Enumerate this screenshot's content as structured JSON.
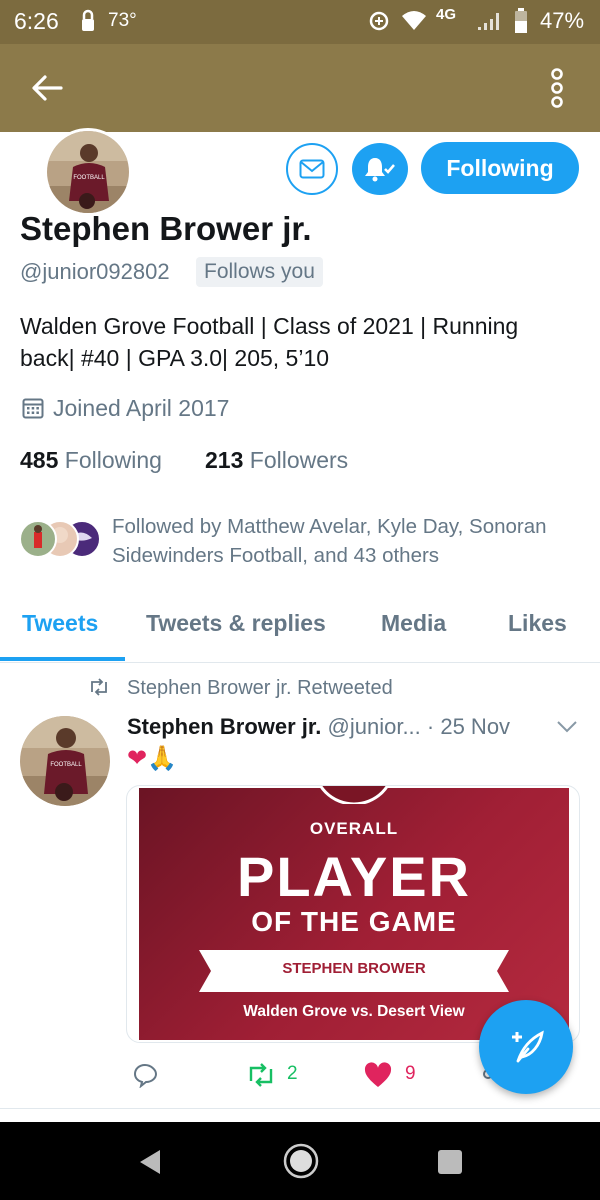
{
  "status": {
    "time": "6:26",
    "temp": "73°",
    "network": "4G",
    "battery": "47%"
  },
  "profile": {
    "name": "Stephen Brower jr.",
    "handle": "@junior092802",
    "follows_badge": "Follows you",
    "bio_line1": "Walden Grove Football | Class of 2021 | Running",
    "bio_line2": "back| #40 | GPA 3.0| 205, 5’10",
    "joined": "Joined April 2017",
    "following_count": "485",
    "following_label": "Following",
    "followers_count": "213",
    "followers_label": "Followers",
    "followed_by_line1": "Followed by Matthew Avelar, Kyle Day, Sonoran",
    "followed_by_line2": "Sidewinders Football, and 43 others",
    "follow_button": "Following"
  },
  "tabs": [
    {
      "label": "Tweets",
      "active": true
    },
    {
      "label": "Tweets & replies",
      "active": false
    },
    {
      "label": "Media",
      "active": false
    },
    {
      "label": "Likes",
      "active": false
    }
  ],
  "tweet": {
    "retweet_note": "Stephen Brower jr. Retweeted",
    "author": "Stephen Brower jr.",
    "handle": "@junior...",
    "date": "· 25 Nov",
    "text": "❤🙏",
    "card": {
      "overall": "OVERALL",
      "player": "PLAYER",
      "of_the_game": "OF THE GAME",
      "player_name": "STEPHEN BROWER",
      "matchup": "Walden Grove vs. Desert View"
    },
    "retweets": "2",
    "likes": "9"
  },
  "colors": {
    "accent": "#1da1f2",
    "appbar": "#8c7a4a",
    "card": "#a01f35"
  }
}
